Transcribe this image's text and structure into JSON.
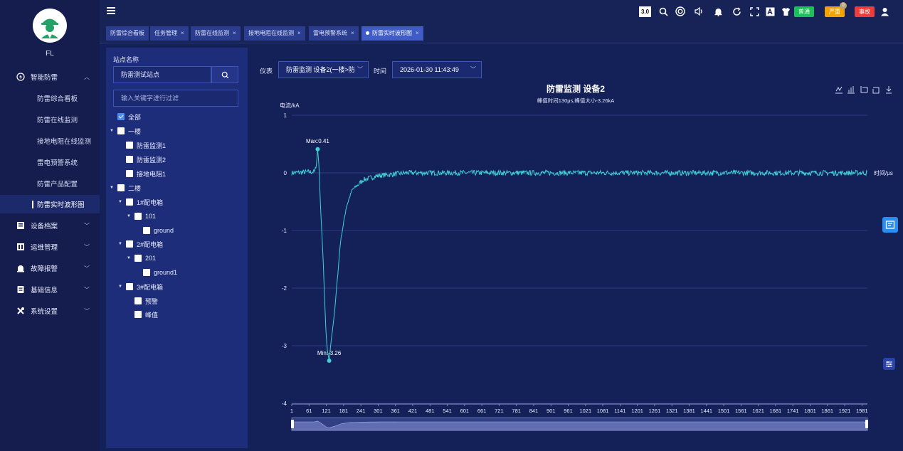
{
  "user": {
    "name": "FL"
  },
  "sidebar": {
    "group_lightning": {
      "label": "智能防雷"
    },
    "sub_items": [
      {
        "label": "防雷综合看板"
      },
      {
        "label": "防雷在线监测"
      },
      {
        "label": "接地电阻在线监测"
      },
      {
        "label": "雷电预警系统"
      },
      {
        "label": "防雷产品配置"
      },
      {
        "label": "防雷实时波形图"
      }
    ],
    "groups": [
      {
        "label": "设备档案"
      },
      {
        "label": "运维管理"
      },
      {
        "label": "故障报警"
      },
      {
        "label": "基础信息"
      },
      {
        "label": "系统设置"
      }
    ]
  },
  "topbar": {
    "version": "3.0",
    "badges": [
      {
        "label": "普通",
        "color": "#1ebe5a"
      },
      {
        "label": "严重",
        "color": "#f5a200"
      },
      {
        "label": "事故",
        "color": "#ee3b3b"
      }
    ]
  },
  "tabs": [
    {
      "label": "防雷综合看板",
      "closable": false
    },
    {
      "label": "任务管理",
      "closable": true
    },
    {
      "label": "防雷在线监测",
      "closable": true
    },
    {
      "label": "接地电阻在线监测",
      "closable": true
    },
    {
      "label": "雷电预警系统",
      "closable": true
    },
    {
      "label": "防雷实时波形图",
      "closable": true,
      "active": true
    }
  ],
  "tree": {
    "title": "站点名称",
    "station": "防雷测试站点",
    "filter_placeholder": "输入关键字进行过滤",
    "nodes": [
      {
        "label": "全部",
        "checked": true
      },
      {
        "label": "一楼"
      },
      {
        "label": "防雷监测1"
      },
      {
        "label": "防雷监测2"
      },
      {
        "label": "接地电阻1"
      },
      {
        "label": "二楼"
      },
      {
        "label": "1#配电箱"
      },
      {
        "label": "101"
      },
      {
        "label": "ground"
      },
      {
        "label": "2#配电箱"
      },
      {
        "label": "201"
      },
      {
        "label": "ground1"
      },
      {
        "label": "3#配电箱"
      },
      {
        "label": "预警"
      },
      {
        "label": "峰值"
      }
    ]
  },
  "controls": {
    "device_label": "仪表",
    "device_value": "防雷监测 设备2(一楼>防",
    "time_label": "时间",
    "time_value": "2026-01-30 11:43:49"
  },
  "chart_data": {
    "type": "line",
    "title": "防雷监测 设备2",
    "subtitle": "峰值时间130μs,峰值大小-3.26kA",
    "ylabel": "电流/kA",
    "xlabel": "时间/μs",
    "ylim": [
      -4,
      1
    ],
    "yticks": [
      1,
      0,
      -1,
      -2,
      -3,
      -4
    ],
    "xticks": [
      1,
      61,
      121,
      181,
      241,
      301,
      361,
      421,
      481,
      541,
      601,
      661,
      721,
      781,
      841,
      901,
      961,
      1021,
      1081,
      1141,
      1201,
      1261,
      1321,
      1381,
      1441,
      1501,
      1561,
      1621,
      1681,
      1741,
      1801,
      1861,
      1921,
      1981
    ],
    "xrange": [
      1,
      2000
    ],
    "series": [
      {
        "color": "#3fd0d4",
        "peak_max": {
          "x": 91,
          "y": 0.41,
          "label": "Max:0.41"
        },
        "peak_min": {
          "x": 131,
          "y": -3.26,
          "label": "Min:-3.26"
        },
        "keypoints": [
          [
            1,
            0
          ],
          [
            80,
            0.02
          ],
          [
            86,
            0.1
          ],
          [
            91,
            0.41
          ],
          [
            96,
            0.1
          ],
          [
            100,
            -0.5
          ],
          [
            110,
            -1.5
          ],
          [
            120,
            -2.8
          ],
          [
            125,
            -3.1
          ],
          [
            131,
            -3.26
          ],
          [
            136,
            -3.0
          ],
          [
            150,
            -2.4
          ],
          [
            170,
            -1.2
          ],
          [
            190,
            -0.6
          ],
          [
            210,
            -0.3
          ],
          [
            250,
            -0.12
          ],
          [
            300,
            -0.05
          ],
          [
            400,
            0
          ],
          [
            2000,
            0
          ]
        ]
      }
    ],
    "grid": true,
    "datazoom": true
  }
}
